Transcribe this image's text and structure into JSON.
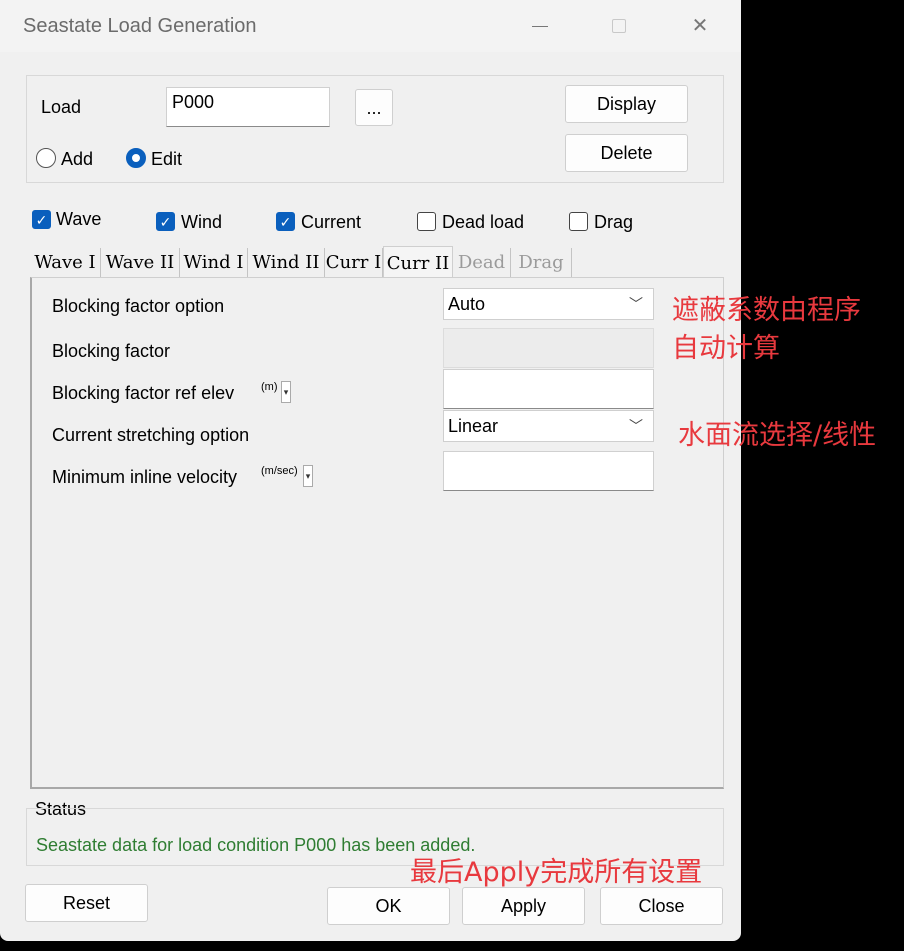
{
  "window": {
    "title": "Seastate Load Generation"
  },
  "load": {
    "label": "Load",
    "value": "P000",
    "browse_label": "...",
    "display_label": "Display",
    "delete_label": "Delete"
  },
  "mode": {
    "add_label": "Add",
    "edit_label": "Edit",
    "selected": "Edit"
  },
  "options": [
    {
      "label": "Wave",
      "checked": true
    },
    {
      "label": "Wind",
      "checked": true
    },
    {
      "label": "Current",
      "checked": true
    },
    {
      "label": "Dead load",
      "checked": false
    },
    {
      "label": "Drag",
      "checked": false
    }
  ],
  "tabs": [
    {
      "label": "Wave I",
      "state": "normal"
    },
    {
      "label": "Wave II",
      "state": "normal"
    },
    {
      "label": "Wind I",
      "state": "normal"
    },
    {
      "label": "Wind II",
      "state": "normal"
    },
    {
      "label": "Curr I",
      "state": "normal"
    },
    {
      "label": "Curr II",
      "state": "active"
    },
    {
      "label": "Dead",
      "state": "disabled"
    },
    {
      "label": "Drag",
      "state": "disabled"
    }
  ],
  "fields": {
    "blocking_option": {
      "label": "Blocking factor option",
      "value": "Auto"
    },
    "blocking_factor": {
      "label": "Blocking factor",
      "value": ""
    },
    "blocking_ref": {
      "label": "Blocking factor ref elev",
      "unit": "(m)",
      "value": ""
    },
    "stretching": {
      "label": "Current stretching option",
      "value": "Linear"
    },
    "min_velocity": {
      "label": "Minimum inline velocity",
      "unit": "(m/sec)",
      "value": ""
    }
  },
  "status": {
    "label": "Status",
    "message": "Seastate data for load condition P000 has been added."
  },
  "buttons": {
    "reset": "Reset",
    "ok": "OK",
    "apply": "Apply",
    "close": "Close"
  },
  "annotations": {
    "note1_line1": "遮蔽系数由程序",
    "note1_line2": "自动计算",
    "note2": "水面流选择/线性",
    "note3": "最后Apply完成所有设置",
    "color": "#e8393e"
  }
}
